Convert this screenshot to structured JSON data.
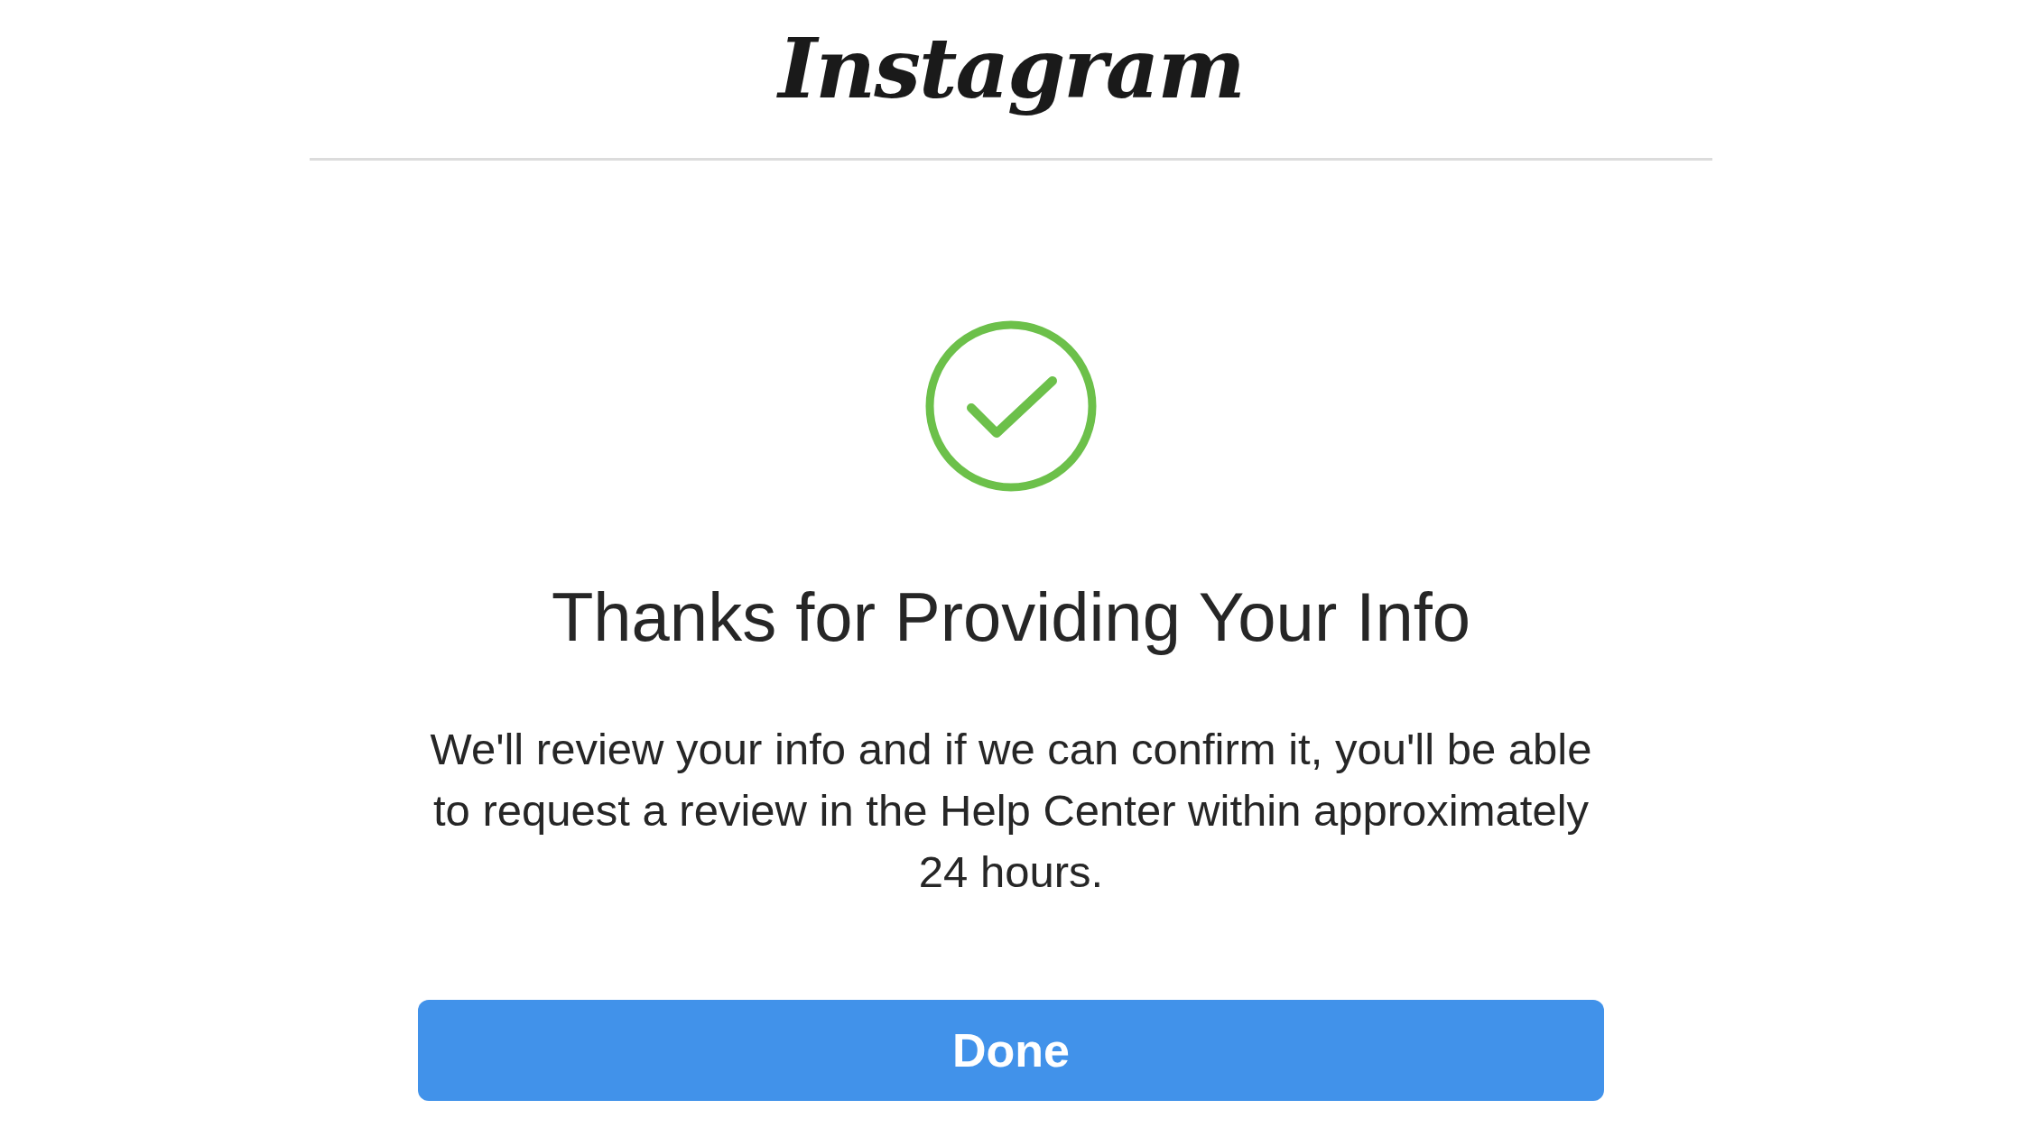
{
  "header": {
    "logo": "Instagram"
  },
  "confirmation": {
    "title": "Thanks for Providing Your Info",
    "message": "We'll review your info and if we can confirm it, you'll be able to request a review in the Help Center within approximately 24 hours."
  },
  "buttons": [
    {
      "label": "Done"
    }
  ]
}
